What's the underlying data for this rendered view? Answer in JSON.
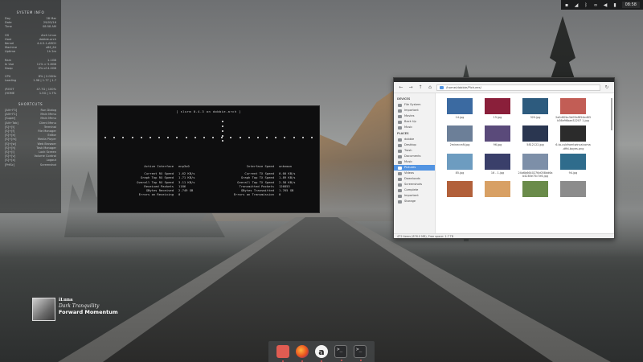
{
  "tray": {
    "icons": [
      "window-icon",
      "network-icon",
      "bluetooth-icon",
      "link-icon",
      "volume-icon",
      "battery-icon"
    ],
    "clock": "08:58"
  },
  "conky": {
    "system_header": "SYSTEM INFO",
    "system_rows": [
      {
        "k": "Day",
        "v": "28 Mar"
      },
      {
        "k": "Date",
        "v": "29/03/16"
      },
      {
        "k": "Time",
        "v": "08:58 AM"
      }
    ],
    "host_rows": [
      {
        "k": "OS",
        "v": "Arch Linux"
      },
      {
        "k": "Host",
        "v": "dobbie-arch"
      },
      {
        "k": "Kernel",
        "v": "4.4.5-1-ARCH"
      },
      {
        "k": "Machine",
        "v": "x86_64"
      },
      {
        "k": "Uptime",
        "v": "1h 2m"
      }
    ],
    "res_rows": [
      {
        "k": "Ram",
        "v": "1.1GB"
      },
      {
        "k": "In Use",
        "v": "11% > 5.8GB"
      },
      {
        "k": "Swap",
        "v": "0% of 4.0GB"
      }
    ],
    "cpu_rows": [
      {
        "k": "CPU",
        "v": "8% | 2.0GHz"
      },
      {
        "k": "Loading",
        "v": "1.98 | 1.77 | 1.7"
      }
    ],
    "disk_rows": [
      {
        "k": "/ROOT",
        "v": "47.7G | 100%"
      },
      {
        "k": "/HOME",
        "v": "1.5G | 1.7%"
      }
    ],
    "shortcuts_header": "SHORTCUTS",
    "shortcut_rows": [
      {
        "k": "[Alt+F3]",
        "v": "Run Dialog"
      },
      {
        "k": "[Alt+F1]",
        "v": "Main Menu"
      },
      {
        "k": "[Super]",
        "v": "Main Menu"
      },
      {
        "k": "[Alt+Tab]",
        "v": "Client Menu"
      },
      {
        "k": "[S]+[t]",
        "v": "Terminal"
      },
      {
        "k": "[S]+[f]",
        "v": "File Manager"
      },
      {
        "k": "[S]+[e]",
        "v": "Editor"
      },
      {
        "k": "[S]+[m]",
        "v": "Media Player"
      },
      {
        "k": "[S]+[w]",
        "v": "Web Browser"
      },
      {
        "k": "[S]+[h]",
        "v": "Task Manager"
      },
      {
        "k": "[S]+[l]",
        "v": "Lock Screen"
      },
      {
        "k": "[S]+[v]",
        "v": "Volume Control"
      },
      {
        "k": "[S]+[x]",
        "v": "Logout"
      },
      {
        "k": "[PrtSc]",
        "v": "Screenshot"
      }
    ]
  },
  "terminal": {
    "title": "[ slurm 0.4.3 on dobbie-arch ]",
    "left": [
      {
        "k": "Active Interface",
        "v": "enp3s0"
      },
      {
        "k": "Current RX Speed",
        "v": "1.62 KB/s"
      },
      {
        "k": "Graph Top RX Speed",
        "v": "1.71 KB/s"
      },
      {
        "k": "Overall Top RX Speed",
        "v": "3.11 KB/s"
      },
      {
        "k": "Received Packets",
        "v": "1186"
      },
      {
        "k": "GBytes Received",
        "v": "2.749 GB"
      },
      {
        "k": "Errors on Receiving",
        "v": "0"
      }
    ],
    "right": [
      {
        "k": "Interface Speed",
        "v": "unknown"
      },
      {
        "k": "Current TX Speed",
        "v": "0.00 KB/s"
      },
      {
        "k": "Graph Top TX Speed",
        "v": "1.89 KB/s"
      },
      {
        "k": "Overall Top TX Speed",
        "v": "2.58 KB/s"
      },
      {
        "k": "Transmitted Packets",
        "v": "126853"
      },
      {
        "k": "GBytes Transmitted",
        "v": "1.765 GB"
      },
      {
        "k": "Errors on Transmission",
        "v": "0"
      }
    ]
  },
  "file_manager": {
    "path": "/home/dobbie/Pictures/",
    "devices_header": "DEVICES",
    "devices": [
      "File System",
      "Important",
      "Movies",
      "Back Up",
      "Music"
    ],
    "places_header": "PLACES",
    "places": [
      "dobbie",
      "Desktop",
      "Trash",
      "Documents",
      "Music",
      "Pictures",
      "Videos",
      "Downloads",
      "Screenshots",
      "Complete",
      "Important",
      "Storage"
    ],
    "selected_place": "Pictures",
    "files": [
      {
        "name": "14.jpg",
        "color": "#3b6aa1"
      },
      {
        "name": "15.jpg",
        "color": "#8a1f3a"
      },
      {
        "name": "320.jpg",
        "color": "#2d5b7e"
      },
      {
        "name": "2a0d62bc5d05bf854ed83b36e96bae32207 1.jpg",
        "color": "#c25d55"
      },
      {
        "name": "2minecraft.jpg",
        "color": "#6c7f98"
      },
      {
        "name": "96.jpg",
        "color": "#5a4a7a"
      },
      {
        "name": "5812122.jpg",
        "color": "#2a3650"
      },
      {
        "name": "6-to-cubfromtwincalcoma-dffd-boyes.png",
        "color": "#2b2b2b"
      },
      {
        "name": "85.jpg",
        "color": "#6d9cc0"
      },
      {
        "name": "16 - 1.jpg",
        "color": "#3a3f6a"
      },
      {
        "name": "24a6b6640276d058dd6ab4285e75c7e6.jpg",
        "color": "#7d8fa8"
      },
      {
        "name": "94.jpg",
        "color": "#2f6c8c"
      },
      {
        "name": "",
        "color": "#b2603a"
      },
      {
        "name": "",
        "color": "#d8a064"
      },
      {
        "name": "",
        "color": "#6a8b4a"
      },
      {
        "name": "",
        "color": "#8c8c8c"
      }
    ],
    "status": "472 items (876.0 MB), Free space: 1.7 TB"
  },
  "album": {
    "artist": "iLuna",
    "album": "Dark Tranquility",
    "song": "Forward Momentum"
  },
  "dock": {
    "apps": [
      "files-icon",
      "firefox-icon",
      "amazon-icon",
      "terminal-icon",
      "terminal-icon"
    ]
  }
}
